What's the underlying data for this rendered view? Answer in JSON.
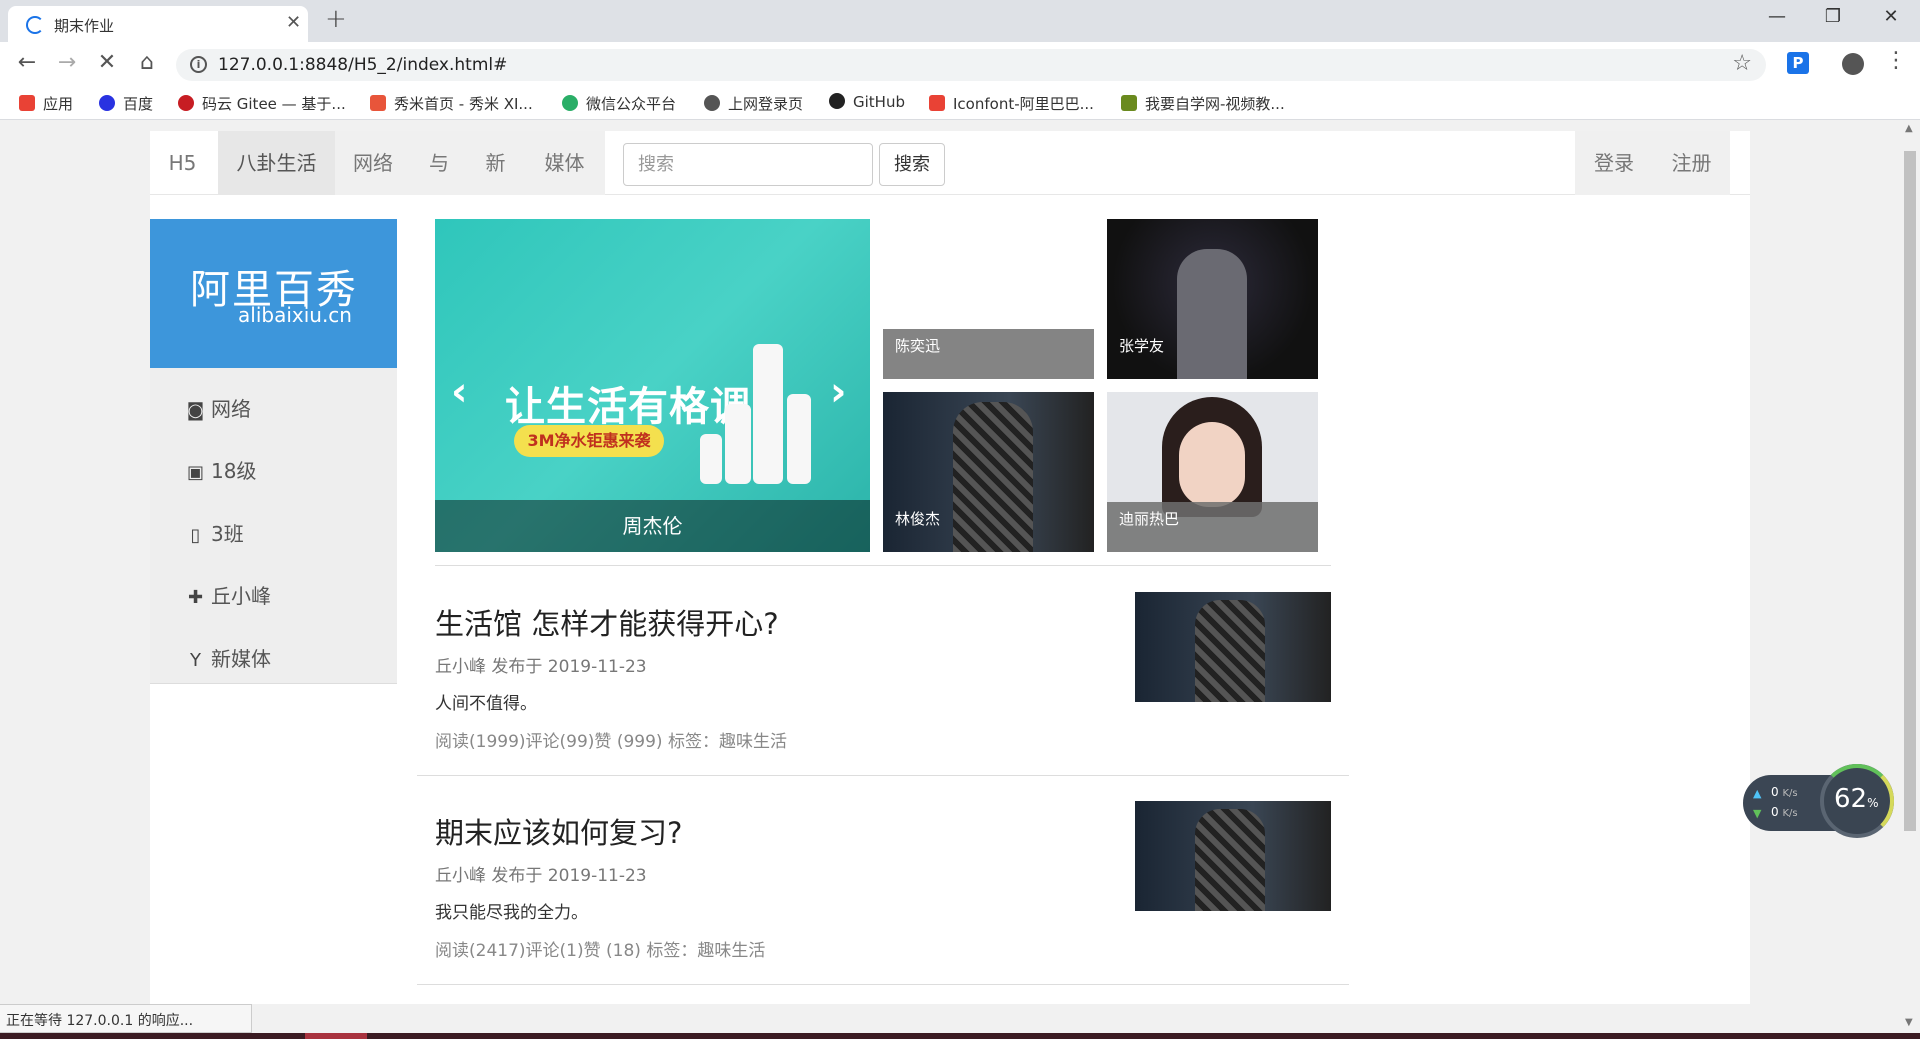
{
  "browser": {
    "tab_title": "期末作业",
    "url": "127.0.0.1:8848/H5_2/index.html#",
    "status_text": "正在等待 127.0.0.1 的响应...",
    "bookmarks": [
      {
        "label": "应用",
        "color": "#e94235"
      },
      {
        "label": "百度",
        "color": "#2932e1"
      },
      {
        "label": "码云 Gitee — 基于...",
        "color": "#c71d23"
      },
      {
        "label": "秀米首页 - 秀米 XI...",
        "color": "#e8553a"
      },
      {
        "label": "微信公众平台",
        "color": "#2aae67"
      },
      {
        "label": "上网登录页",
        "color": "#555555"
      },
      {
        "label": "GitHub",
        "color": "#222222"
      },
      {
        "label": "Iconfont-阿里巴巴...",
        "color": "#e94235"
      },
      {
        "label": "我要自学网-视频教...",
        "color": "#6a8a1e"
      }
    ]
  },
  "navbar": {
    "brand": "H5",
    "items": [
      "八卦生活",
      "网络",
      "与",
      "新",
      "媒体"
    ],
    "search_placeholder": "搜索",
    "search_button": "搜索",
    "login": "登录",
    "register": "注册"
  },
  "sidebar": {
    "logo_cn": "阿里百秀",
    "logo_en": "alibaixiu.cn",
    "items": [
      {
        "label": "网络",
        "icon": "camera-icon"
      },
      {
        "label": "18级",
        "icon": "picture-icon"
      },
      {
        "label": "3班",
        "icon": "phone-icon"
      },
      {
        "label": "丘小峰",
        "icon": "gift-icon"
      },
      {
        "label": "新媒体",
        "icon": "glass-icon"
      }
    ]
  },
  "carousel": {
    "slogan": "让生活有格调",
    "tag": "3M净水钜惠来袭",
    "caption": "周杰伦"
  },
  "thumbnails": [
    "陈奕迅",
    "张学友",
    "林俊杰",
    "迪丽热巴"
  ],
  "articles": [
    {
      "title": "生活馆 怎样才能获得开心?",
      "meta": "丘小峰 发布于 2019-11-23",
      "summary": "人间不值得。",
      "stats": "阅读(1999)评论(99)赞 (999) 标签：趣味生活"
    },
    {
      "title": "期末应该如何复习?",
      "meta": "丘小峰 发布于 2019-11-23",
      "summary": "我只能尽我的全力。",
      "stats": "阅读(2417)评论(1)赞 (18) 标签：趣味生活"
    }
  ],
  "net_widget": {
    "up": "0",
    "down": "0",
    "unit": "K/s",
    "percent": "62",
    "percent_sign": "%"
  }
}
